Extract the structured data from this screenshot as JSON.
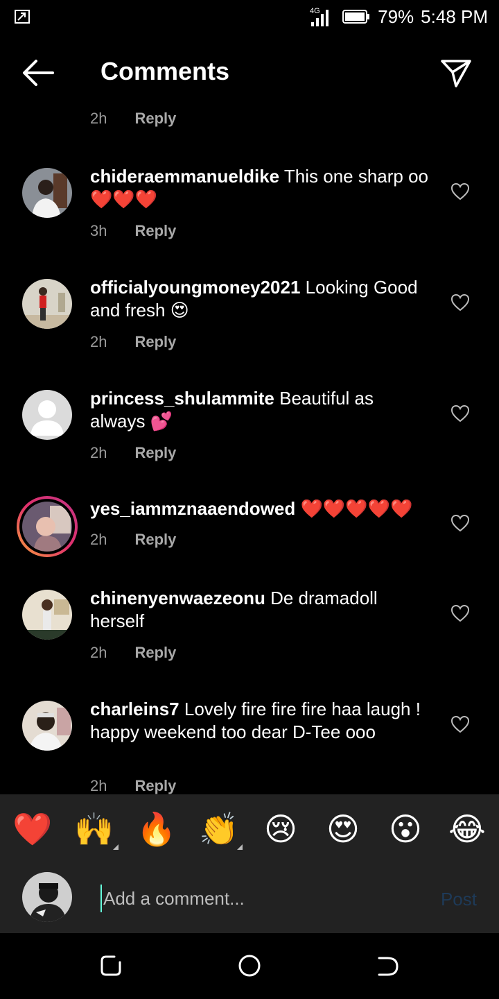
{
  "status": {
    "network": "4G",
    "battery": "79%",
    "time": "5:48 PM"
  },
  "header": {
    "title": "Comments"
  },
  "top_meta": {
    "time": "2h",
    "reply": "Reply"
  },
  "comments": [
    {
      "username": "chideraemmanueldike",
      "text": "This one sharp oo❤️❤️❤️",
      "time": "3h",
      "reply": "Reply"
    },
    {
      "username": "officialyoungmoney2021",
      "text": "Looking Good and fresh 😍",
      "time": "2h",
      "reply": "Reply"
    },
    {
      "username": "princess_shulammite",
      "text": "Beautiful as always 💕",
      "time": "2h",
      "reply": "Reply"
    },
    {
      "username": "yes_iammznaaendowed",
      "text": "❤️❤️❤️❤️❤️",
      "time": "2h",
      "reply": "Reply"
    },
    {
      "username": "chinenyenwaezeonu",
      "text": "De dramadoll herself",
      "time": "2h",
      "reply": "Reply"
    },
    {
      "username": "charleins7",
      "text": "Lovely fire fire fire haa laugh ! happy weekend too dear D-Tee ooo",
      "time": "2h",
      "reply": "Reply"
    }
  ],
  "reactions": [
    "❤️",
    "🙌",
    "🔥",
    "👏",
    "😢",
    "😍",
    "😮",
    "😂"
  ],
  "composer": {
    "placeholder": "Add a comment...",
    "post": "Post"
  },
  "colors": {
    "background": "#000000",
    "panel": "#222222",
    "heart": "#e0242c",
    "post_disabled": "#1e3a58"
  }
}
